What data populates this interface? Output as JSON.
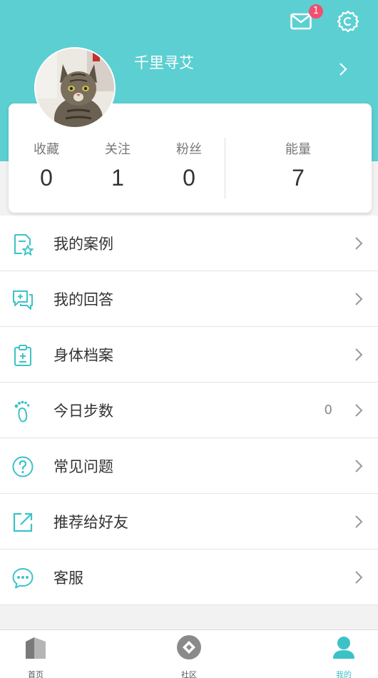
{
  "header": {
    "unread_badge": "1",
    "username": "千里寻艾"
  },
  "stats": [
    {
      "label": "收藏",
      "value": "0"
    },
    {
      "label": "关注",
      "value": "1"
    },
    {
      "label": "粉丝",
      "value": "0"
    },
    {
      "label": "能量",
      "value": "7"
    }
  ],
  "menu": [
    {
      "label": "我的案例",
      "icon": "case-star-icon",
      "value": ""
    },
    {
      "label": "我的回答",
      "icon": "answer-chat-icon",
      "value": ""
    },
    {
      "label": "身体档案",
      "icon": "clipboard-icon",
      "value": ""
    },
    {
      "label": "今日步数",
      "icon": "footprint-icon",
      "value": "0"
    },
    {
      "label": "常见问题",
      "icon": "question-icon",
      "value": ""
    },
    {
      "label": "推荐给好友",
      "icon": "share-icon",
      "value": ""
    },
    {
      "label": "客服",
      "icon": "customer-service-icon",
      "value": ""
    }
  ],
  "tabs": [
    {
      "label": "首页",
      "icon": "home-icon"
    },
    {
      "label": "社区",
      "icon": "community-icon"
    },
    {
      "label": "我的",
      "icon": "profile-icon",
      "active": true
    }
  ],
  "colors": {
    "accent": "#5ccfd2",
    "badge": "#f0506e"
  }
}
